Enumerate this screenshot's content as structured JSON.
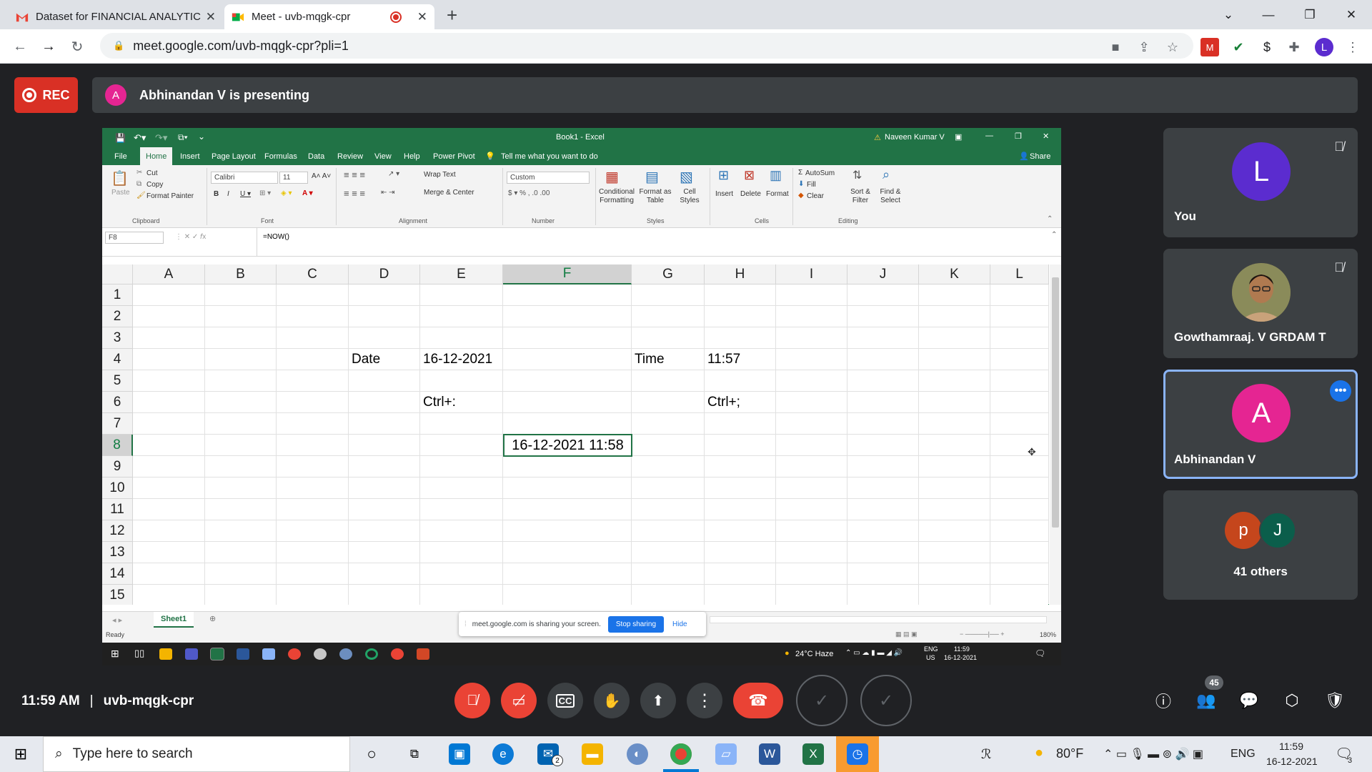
{
  "browser": {
    "tabs": [
      {
        "title": "Dataset for FINANCIAL ANALYTIC",
        "icon": "gmail-icon"
      },
      {
        "title": "Meet - uvb-mqgk-cpr",
        "icon": "meet-icon",
        "recording": true
      }
    ],
    "new_tab_symbol": "+",
    "url": "meet.google.com/uvb-mqgk-cpr?pli=1",
    "profile_initial": "L"
  },
  "meet": {
    "rec_label": "REC",
    "presenter_initial": "A",
    "presenting_text": "Abhinandan V is presenting",
    "time": "11:59 AM",
    "separator": "|",
    "meeting_code": "uvb-mqgk-cpr",
    "people_count": "45",
    "participants": [
      {
        "name": "You",
        "initial": "L",
        "color": "#5b2ccf",
        "muted": true
      },
      {
        "name": "Gowthamraaj. V GRDAM T",
        "initial": "",
        "muted": true
      },
      {
        "name": "Abhinandan V",
        "initial": "A",
        "color": "#e52592",
        "speaking": true
      },
      {
        "name": "41 others",
        "initials": [
          "p",
          "J"
        ],
        "colors": [
          "#c5461c",
          "#0b5e4b"
        ]
      }
    ]
  },
  "excel": {
    "title": "Book1  -  Excel",
    "user": "Naveen Kumar V",
    "menu": [
      "File",
      "Home",
      "Insert",
      "Page Layout",
      "Formulas",
      "Data",
      "Review",
      "View",
      "Help",
      "Power Pivot"
    ],
    "tell_me": "Tell me what you want to do",
    "share": "Share",
    "ribbon": {
      "clipboard": {
        "paste": "Paste",
        "cut": "Cut",
        "copy": "Copy",
        "format_painter": "Format Painter",
        "group": "Clipboard"
      },
      "font": {
        "name": "Calibri",
        "size": "11",
        "group": "Font"
      },
      "alignment": {
        "wrap": "Wrap Text",
        "merge": "Merge & Center",
        "group": "Alignment"
      },
      "number": {
        "format": "Custom",
        "group": "Number"
      },
      "styles": {
        "cond": "Conditional Formatting",
        "table": "Format as Table",
        "cell": "Cell Styles",
        "group": "Styles"
      },
      "cells": {
        "insert": "Insert",
        "delete": "Delete",
        "format": "Format",
        "group": "Cells"
      },
      "editing": {
        "autosum": "AutoSum",
        "fill": "Fill",
        "clear": "Clear",
        "sort": "Sort & Filter",
        "find": "Find & Select",
        "group": "Editing"
      }
    },
    "name_box": "F8",
    "formula": "=NOW()",
    "columns": [
      "A",
      "B",
      "C",
      "D",
      "E",
      "F",
      "G",
      "H",
      "I",
      "J",
      "K",
      "L"
    ],
    "rows": [
      "1",
      "2",
      "3",
      "4",
      "5",
      "6",
      "7",
      "8",
      "9",
      "10",
      "11",
      "12",
      "13",
      "14",
      "15"
    ],
    "cells": {
      "D4": "Date",
      "E4": "16-12-2021",
      "G4": "Time",
      "H4": "11:57",
      "E6": "Ctrl+:",
      "H6": "Ctrl+;",
      "F8": "16-12-2021 11:58"
    },
    "selected_cell": "F8",
    "sheet_tab": "Sheet1",
    "status": "Ready",
    "zoom": "180%",
    "share_notice": {
      "text": "meet.google.com is sharing your screen.",
      "stop": "Stop sharing",
      "hide": "Hide"
    },
    "inner_taskbar": {
      "weather": "24°C  Haze",
      "lang": "ENG",
      "region": "US",
      "time": "11:59",
      "date": "16-12-2021"
    }
  },
  "windows": {
    "search_placeholder": "Type here to search",
    "weather": "80°F",
    "lang": "ENG",
    "time": "11:59",
    "date": "16-12-2021",
    "mail_badge": "2",
    "notif_count": "3"
  }
}
